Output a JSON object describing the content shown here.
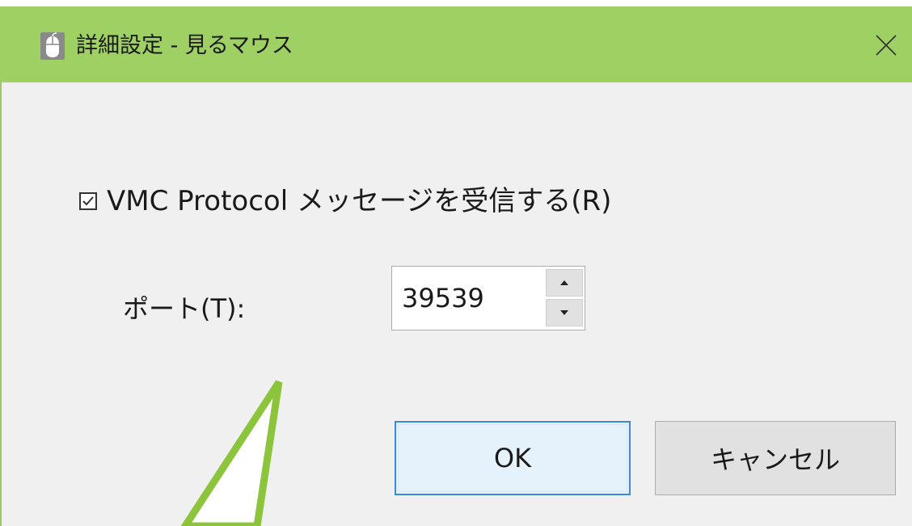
{
  "window": {
    "title": "詳細設定 - 見るマウス",
    "titlebar_color": "#9fd064",
    "icon": "mouse-icon",
    "close_icon": "close-icon"
  },
  "settings": {
    "vmc_checkbox_label": "VMC Protocol メッセージを受信する(R)",
    "vmc_checked": true,
    "port_label": "ポート(T):",
    "port_value": "39539"
  },
  "buttons": {
    "ok_label": "OK",
    "cancel_label": "キャンセル"
  },
  "annotation": {
    "callout_color": "#8cc43c"
  }
}
